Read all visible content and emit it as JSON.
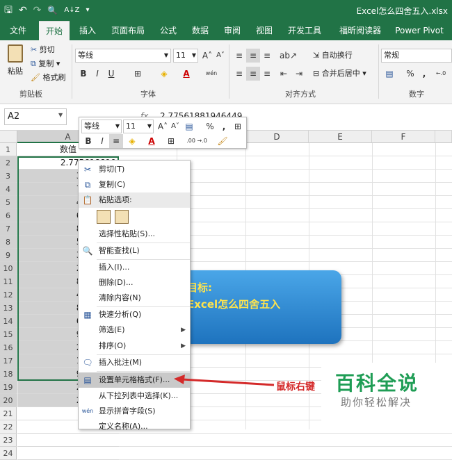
{
  "window": {
    "title": "Excel怎么四舍五入.xlsx"
  },
  "qat": {
    "save": "🖫",
    "undo": "↶",
    "redo": "↷",
    "preview": "🔍",
    "sort": "A↓Z",
    "more": "▾"
  },
  "tabs": [
    "文件",
    "开始",
    "插入",
    "页面布局",
    "公式",
    "数据",
    "审阅",
    "视图",
    "开发工具",
    "福昕阅读器",
    "Power Pivot"
  ],
  "ribbon": {
    "clipboard": {
      "paste": "粘贴",
      "cut": "剪切",
      "copy": "复制",
      "format_painter": "格式刷",
      "label": "剪贴板"
    },
    "font": {
      "name": "等线",
      "size": "11",
      "grow": "A˄",
      "shrink": "A˅",
      "bold": "B",
      "italic": "I",
      "underline": "U",
      "wen": "wén",
      "label": "字体"
    },
    "alignment": {
      "wrap": "自动换行",
      "merge": "合并后居中",
      "label": "对齐方式"
    },
    "number": {
      "format": "常规",
      "percent": "%",
      "comma": ",",
      "label": "数字"
    }
  },
  "formula_bar": {
    "name_box": "A2",
    "fx": "fx",
    "value": "2.77561881946449"
  },
  "columns": [
    "A",
    "B",
    "C",
    "D",
    "E",
    "F"
  ],
  "rows": [
    "1",
    "2",
    "3",
    "4",
    "5",
    "6",
    "7",
    "8",
    "9",
    "10",
    "11",
    "12",
    "13",
    "14",
    "15",
    "16",
    "17",
    "18",
    "19",
    "20",
    "21",
    "22",
    "23",
    "24"
  ],
  "cells_a": [
    "数值",
    "2.775618819",
    "3.311710",
    "7.758409",
    "4.560978",
    "6.428002",
    "8.255516",
    "5.586035",
    "3.020406",
    "2.636601",
    "8.150979",
    "4.047047",
    "8.959711",
    "6.784151",
    "9.745210",
    "2.938855",
    "1.599715",
    "9.791924",
    "2.575119",
    "2.798878"
  ],
  "mini_toolbar": {
    "font": "等线",
    "size": "11",
    "percent": "%",
    "comma": ",",
    "bold": "B",
    "italic": "I",
    "inc_dec": ".00 →.0"
  },
  "context_menu": {
    "cut": "剪切(T)",
    "copy": "复制(C)",
    "paste_options": "粘贴选项:",
    "paste_special": "选择性粘贴(S)...",
    "smart_lookup": "智能查找(L)",
    "insert": "插入(I)...",
    "delete": "删除(D)...",
    "clear": "清除内容(N)",
    "quick_analysis": "快速分析(Q)",
    "filter": "筛选(E)",
    "sort": "排序(O)",
    "insert_comment": "插入批注(M)",
    "format_cells": "设置单元格格式(F)...",
    "pick_list": "从下拉列表中选择(K)...",
    "phonetic": "显示拼音字段(S)",
    "define_name": "定义名称(A)..."
  },
  "banner": {
    "line1": "目标:",
    "line2": "Excel怎么四舍五入"
  },
  "annotation": {
    "text": "鼠标右键",
    "tail": "”"
  },
  "watermark": {
    "title": "百科全说",
    "subtitle": "助你轻松解决"
  },
  "colors": {
    "excel_green": "#217346",
    "arrow_red": "#d42a2a",
    "banner_blue": "#2d86cf",
    "banner_text": "#ffe44d",
    "watermark_green": "#1f9d55"
  }
}
